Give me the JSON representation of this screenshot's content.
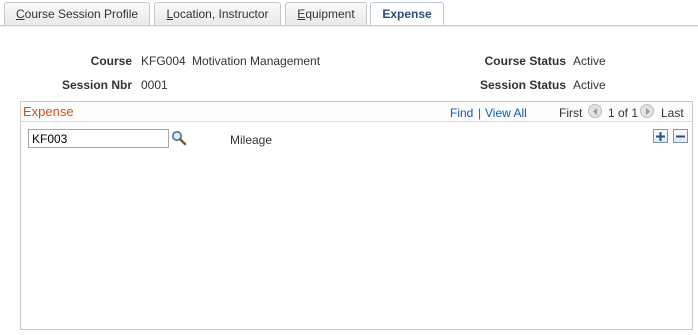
{
  "tabs": [
    {
      "prefix": "",
      "underline": "C",
      "rest": "ourse Session Profile"
    },
    {
      "prefix": "",
      "underline": "L",
      "rest": "ocation, Instructor"
    },
    {
      "prefix": "",
      "underline": "E",
      "rest": "quipment"
    },
    {
      "prefix": "",
      "underline": "",
      "rest": "Expense"
    }
  ],
  "header": {
    "course_label": "Course",
    "course_code": "KFG004",
    "course_name": "Motivation Management",
    "course_status_label": "Course Status",
    "course_status_value": "Active",
    "session_label": "Session Nbr",
    "session_value": "0001",
    "session_status_label": "Session Status",
    "session_status_value": "Active"
  },
  "grid": {
    "title": "Expense",
    "find": "Find",
    "separator": "|",
    "view_all": "View All",
    "first": "First",
    "page_info": "1 of 1",
    "last": "Last",
    "row": {
      "expense_code": "KF003",
      "description": "Mileage"
    }
  },
  "icons": {
    "lookup": "magnifier-icon",
    "prev": "left-arrow-icon",
    "next": "right-arrow-icon",
    "add": "plus-icon",
    "delete": "minus-icon"
  },
  "colors": {
    "grid_title": "#c9531f",
    "link": "#125bab",
    "active_tab_text": "#2c4c75"
  }
}
